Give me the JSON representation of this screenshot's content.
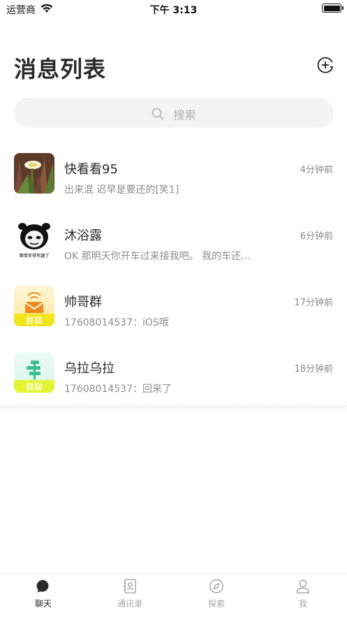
{
  "status_bar": {
    "carrier": "运营商",
    "time": "下午 3:13",
    "battery_level": 1.0
  },
  "header": {
    "title": "消息列表",
    "add_icon": "add-circle-icon"
  },
  "search": {
    "placeholder": "搜索",
    "icon": "search-icon"
  },
  "conversations": [
    {
      "name": "快看看95",
      "time": "4分钟前",
      "preview": "出来混 迟早是要还的[笑1]",
      "avatar": "flower-photo"
    },
    {
      "name": "沐浴露",
      "time": "6分钟前",
      "preview": "OK 那明天你开车过来接我吧。 我的车还…",
      "avatar": "panda-meme",
      "avatar_caption": "事情变得有趣了"
    },
    {
      "name": "帅哥群",
      "time": "17分钟前",
      "preview": "17608014537：iOS哦",
      "avatar": "group-mail",
      "avatar_caption": "群聊"
    },
    {
      "name": "乌拉乌拉",
      "time": "18分钟前",
      "preview": "17608014537：回来了",
      "avatar": "group-tree",
      "avatar_caption": "群聊"
    }
  ],
  "tabs": [
    {
      "label": "聊天",
      "icon": "chat-bubble-icon",
      "active": true
    },
    {
      "label": "通讯录",
      "icon": "contacts-icon",
      "active": false
    },
    {
      "label": "探索",
      "icon": "compass-icon",
      "active": false
    },
    {
      "label": "我",
      "icon": "person-icon",
      "active": false
    }
  ],
  "colors": {
    "accent": "#2a2a2a",
    "inactive": "#a8a8a8",
    "search_bg": "#f4f4f4",
    "group_mail_top": "#fff3c4",
    "group_mail_bottom": "#f3e600",
    "group_tree_top": "#e6f8ef",
    "group_tree_bottom": "#e3f43a"
  }
}
